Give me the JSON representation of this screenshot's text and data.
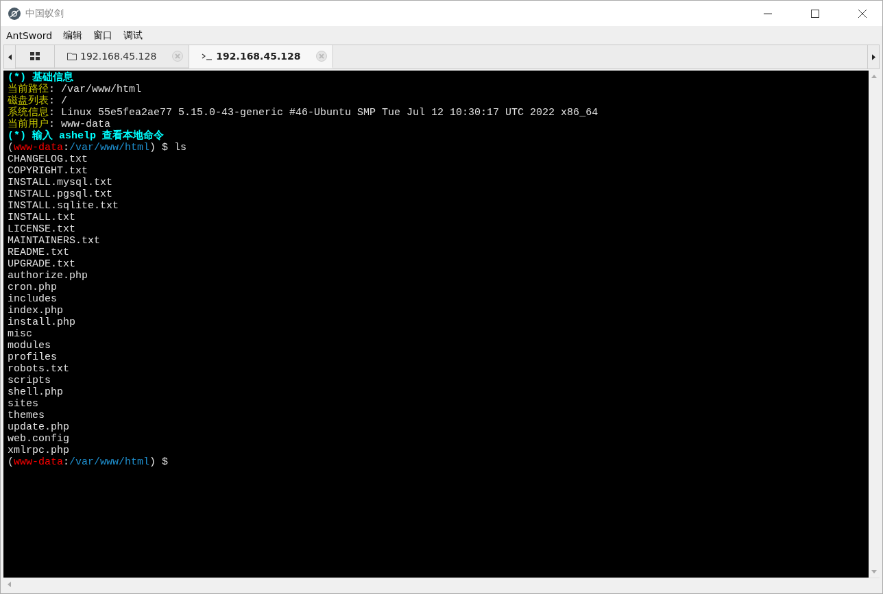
{
  "window": {
    "title": "中国蚁剑"
  },
  "menu": [
    "AntSword",
    "编辑",
    "窗口",
    "调试"
  ],
  "tabs": [
    {
      "kind": "home",
      "selected": false
    },
    {
      "kind": "folder",
      "label": "192.168.45.128",
      "selected": false
    },
    {
      "kind": "terminal",
      "label": "192.168.45.128",
      "selected": true
    }
  ],
  "terminal": {
    "lines": [
      {
        "bold": true,
        "segments": [
          {
            "text": "(*) 基础信息",
            "color": "#00ffff"
          }
        ]
      },
      {
        "bold": false,
        "segments": [
          {
            "text": "当前路径",
            "color": "#c0c000"
          },
          {
            "text": ": /var/www/html",
            "color": "#e0e0e0"
          }
        ]
      },
      {
        "bold": false,
        "segments": [
          {
            "text": "磁盘列表",
            "color": "#c0c000"
          },
          {
            "text": ": /",
            "color": "#e0e0e0"
          }
        ]
      },
      {
        "bold": false,
        "segments": [
          {
            "text": "系统信息",
            "color": "#c0c000"
          },
          {
            "text": ": Linux 55e5fea2ae77 5.15.0-43-generic #46-Ubuntu SMP Tue Jul 12 10:30:17 UTC 2022 x86_64",
            "color": "#e0e0e0"
          }
        ]
      },
      {
        "bold": false,
        "segments": [
          {
            "text": "当前用户",
            "color": "#c0c000"
          },
          {
            "text": ": www-data",
            "color": "#e0e0e0"
          }
        ]
      },
      {
        "bold": true,
        "segments": [
          {
            "text": "(*) 输入 ashelp 查看本地命令",
            "color": "#00ffff"
          }
        ]
      },
      {
        "bold": false,
        "segments": [
          {
            "text": "(",
            "color": "#e0e0e0"
          },
          {
            "text": "www-data",
            "color": "#ff0000"
          },
          {
            "text": ":",
            "color": "#e0e0e0"
          },
          {
            "text": "/var/www/html",
            "color": "#1e90d0"
          },
          {
            "text": ") $ ls",
            "color": "#e0e0e0"
          }
        ]
      },
      {
        "bold": false,
        "segments": [
          {
            "text": "CHANGELOG.txt",
            "color": "#e0e0e0"
          }
        ]
      },
      {
        "bold": false,
        "segments": [
          {
            "text": "COPYRIGHT.txt",
            "color": "#e0e0e0"
          }
        ]
      },
      {
        "bold": false,
        "segments": [
          {
            "text": "INSTALL.mysql.txt",
            "color": "#e0e0e0"
          }
        ]
      },
      {
        "bold": false,
        "segments": [
          {
            "text": "INSTALL.pgsql.txt",
            "color": "#e0e0e0"
          }
        ]
      },
      {
        "bold": false,
        "segments": [
          {
            "text": "INSTALL.sqlite.txt",
            "color": "#e0e0e0"
          }
        ]
      },
      {
        "bold": false,
        "segments": [
          {
            "text": "INSTALL.txt",
            "color": "#e0e0e0"
          }
        ]
      },
      {
        "bold": false,
        "segments": [
          {
            "text": "LICENSE.txt",
            "color": "#e0e0e0"
          }
        ]
      },
      {
        "bold": false,
        "segments": [
          {
            "text": "MAINTAINERS.txt",
            "color": "#e0e0e0"
          }
        ]
      },
      {
        "bold": false,
        "segments": [
          {
            "text": "README.txt",
            "color": "#e0e0e0"
          }
        ]
      },
      {
        "bold": false,
        "segments": [
          {
            "text": "UPGRADE.txt",
            "color": "#e0e0e0"
          }
        ]
      },
      {
        "bold": false,
        "segments": [
          {
            "text": "authorize.php",
            "color": "#e0e0e0"
          }
        ]
      },
      {
        "bold": false,
        "segments": [
          {
            "text": "cron.php",
            "color": "#e0e0e0"
          }
        ]
      },
      {
        "bold": false,
        "segments": [
          {
            "text": "includes",
            "color": "#e0e0e0"
          }
        ]
      },
      {
        "bold": false,
        "segments": [
          {
            "text": "index.php",
            "color": "#e0e0e0"
          }
        ]
      },
      {
        "bold": false,
        "segments": [
          {
            "text": "install.php",
            "color": "#e0e0e0"
          }
        ]
      },
      {
        "bold": false,
        "segments": [
          {
            "text": "misc",
            "color": "#e0e0e0"
          }
        ]
      },
      {
        "bold": false,
        "segments": [
          {
            "text": "modules",
            "color": "#e0e0e0"
          }
        ]
      },
      {
        "bold": false,
        "segments": [
          {
            "text": "profiles",
            "color": "#e0e0e0"
          }
        ]
      },
      {
        "bold": false,
        "segments": [
          {
            "text": "robots.txt",
            "color": "#e0e0e0"
          }
        ]
      },
      {
        "bold": false,
        "segments": [
          {
            "text": "scripts",
            "color": "#e0e0e0"
          }
        ]
      },
      {
        "bold": false,
        "segments": [
          {
            "text": "shell.php",
            "color": "#e0e0e0"
          }
        ]
      },
      {
        "bold": false,
        "segments": [
          {
            "text": "sites",
            "color": "#e0e0e0"
          }
        ]
      },
      {
        "bold": false,
        "segments": [
          {
            "text": "themes",
            "color": "#e0e0e0"
          }
        ]
      },
      {
        "bold": false,
        "segments": [
          {
            "text": "update.php",
            "color": "#e0e0e0"
          }
        ]
      },
      {
        "bold": false,
        "segments": [
          {
            "text": "web.config",
            "color": "#e0e0e0"
          }
        ]
      },
      {
        "bold": false,
        "segments": [
          {
            "text": "xmlrpc.php",
            "color": "#e0e0e0"
          }
        ]
      },
      {
        "bold": false,
        "segments": [
          {
            "text": "(",
            "color": "#e0e0e0"
          },
          {
            "text": "www-data",
            "color": "#ff0000"
          },
          {
            "text": ":",
            "color": "#e0e0e0"
          },
          {
            "text": "/var/www/html",
            "color": "#1e90d0"
          },
          {
            "text": ") $",
            "color": "#e0e0e0"
          }
        ]
      }
    ]
  }
}
